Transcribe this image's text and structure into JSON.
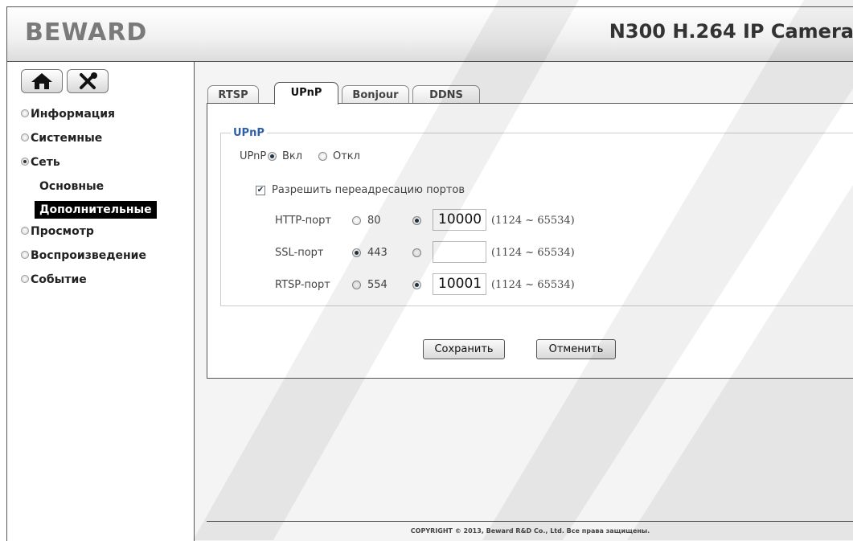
{
  "header": {
    "logo": "BEWARD",
    "model": "N300 H.264 IP Camera"
  },
  "toolbar": {
    "home_icon": "home-icon",
    "settings_icon": "tools-icon"
  },
  "sidebar": {
    "items": [
      {
        "label": "Информация",
        "selected": false
      },
      {
        "label": "Системные",
        "selected": false
      },
      {
        "label": "Сеть",
        "selected": true
      },
      {
        "label": "Просмотр",
        "selected": false
      },
      {
        "label": "Воспроизведение",
        "selected": false
      },
      {
        "label": "Событие",
        "selected": false
      }
    ],
    "subitems": [
      {
        "label": "Основные",
        "active": false
      },
      {
        "label": "Дополнительные",
        "active": true
      }
    ]
  },
  "tabs": [
    {
      "label": "RTSP",
      "active": false
    },
    {
      "label": "UPnP",
      "active": true
    },
    {
      "label": "Bonjour",
      "active": false
    },
    {
      "label": "DDNS",
      "active": false
    }
  ],
  "upnp": {
    "legend": "UPnP",
    "label": "UPnP",
    "on_label": "Вкл",
    "off_label": "Откл",
    "enabled": true,
    "forward_label": "Разрешить переадресацию портов",
    "forward_checked": true,
    "ports": [
      {
        "label": "HTTP-порт",
        "default": "80",
        "custom_selected": true,
        "value": "10000",
        "range": "(1124 ~ 65534)"
      },
      {
        "label": "SSL-порт",
        "default": "443",
        "custom_selected": false,
        "value": "",
        "range": "(1124 ~ 65534)"
      },
      {
        "label": "RTSP-порт",
        "default": "554",
        "custom_selected": true,
        "value": "10001",
        "range": "(1124 ~ 65534)"
      }
    ]
  },
  "buttons": {
    "save": "Сохранить",
    "cancel": "Отменить"
  },
  "footer": "COPYRIGHT © 2013, Beward R&D Co., Ltd. Все права защищены.",
  "colors": {
    "legend": "#2e5fa8",
    "active_menu_bg": "#000000"
  }
}
